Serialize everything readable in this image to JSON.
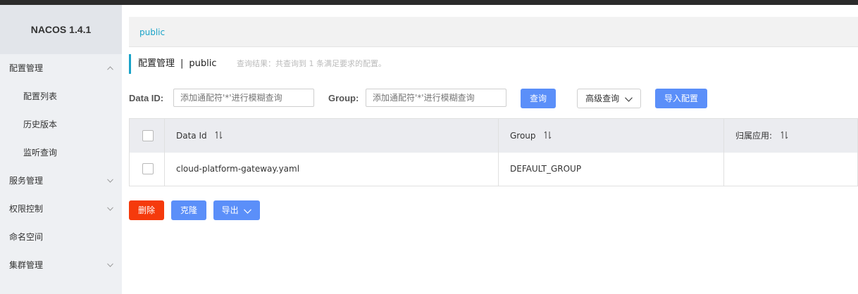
{
  "app": {
    "brand": "NACOS 1.4.1"
  },
  "sidebar": {
    "items": [
      {
        "label": "配置管理",
        "expanded": true
      },
      {
        "label": "服务管理"
      },
      {
        "label": "权限控制"
      },
      {
        "label": "命名空间"
      },
      {
        "label": "集群管理"
      }
    ],
    "sub_items": [
      {
        "label": "配置列表"
      },
      {
        "label": "历史版本"
      },
      {
        "label": "监听查询"
      }
    ]
  },
  "breadcrumb": {
    "namespace": "public"
  },
  "page": {
    "title": "配置管理",
    "separator": "|",
    "namespace": "public",
    "result_text": "查询结果：共查询到 1 条满足要求的配置。"
  },
  "filters": {
    "data_id_label": "Data ID:",
    "data_id_placeholder": "添加通配符'*'进行模糊查询",
    "group_label": "Group:",
    "group_placeholder": "添加通配符'*'进行模糊查询",
    "query_button": "查询",
    "advanced_button": "高级查询",
    "import_button": "导入配置"
  },
  "table": {
    "columns": [
      "Data Id",
      "Group",
      "归属应用:"
    ],
    "rows": [
      {
        "data_id": "cloud-platform-gateway.yaml",
        "group": "DEFAULT_GROUP",
        "app": ""
      }
    ]
  },
  "actions": {
    "delete": "删除",
    "clone": "克隆",
    "export": "导出"
  },
  "colors": {
    "accent": "#1aa3c8",
    "primary": "#5b8ff9",
    "danger": "#f53a0c"
  }
}
